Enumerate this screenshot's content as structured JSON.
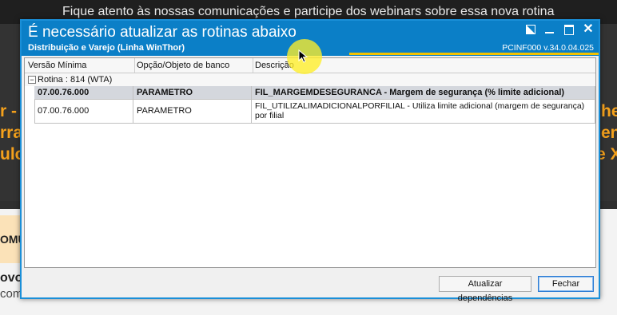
{
  "background": {
    "notice": "Fique atento às nossas comunicações e participe dos webinars sobre essa nova rotina",
    "left_orange_lines": [
      "r -",
      "rra",
      "ulo"
    ],
    "right_orange_lines": [
      "he",
      "en",
      "e X"
    ],
    "left_bold_text": "OMU",
    "left_line_1": "ovo",
    "left_line_2": "com"
  },
  "dialog": {
    "title": "É necessário atualizar as rotinas abaixo",
    "subtitle": "Distribuição e Varejo (Linha WinThor)",
    "version": "PCINF000  v.34.0.04.025",
    "accent_color": "#0b7fc7",
    "highlight_color": "#f3c200"
  },
  "grid": {
    "columns": [
      "Versão Mínima",
      "Opção/Objeto de banco",
      "Descrição"
    ],
    "group": {
      "expander": "−",
      "label": "Rotina : 814 (WTA)"
    },
    "rows": [
      {
        "versao": "07.00.76.000",
        "objeto": "PARAMETRO",
        "descricao": "FIL_MARGEMDESEGURANCA - Margem de segurança (% limite adicional)",
        "selected": true
      },
      {
        "versao": "07.00.76.000",
        "objeto": "PARAMETRO",
        "descricao": "FIL_UTILIZALIMADICIONALPORFILIAL - Utiliza limite adicional (margem de segurança) por filial",
        "selected": false
      }
    ]
  },
  "buttons": {
    "update": "Atualizar dependências",
    "close": "Fechar"
  }
}
